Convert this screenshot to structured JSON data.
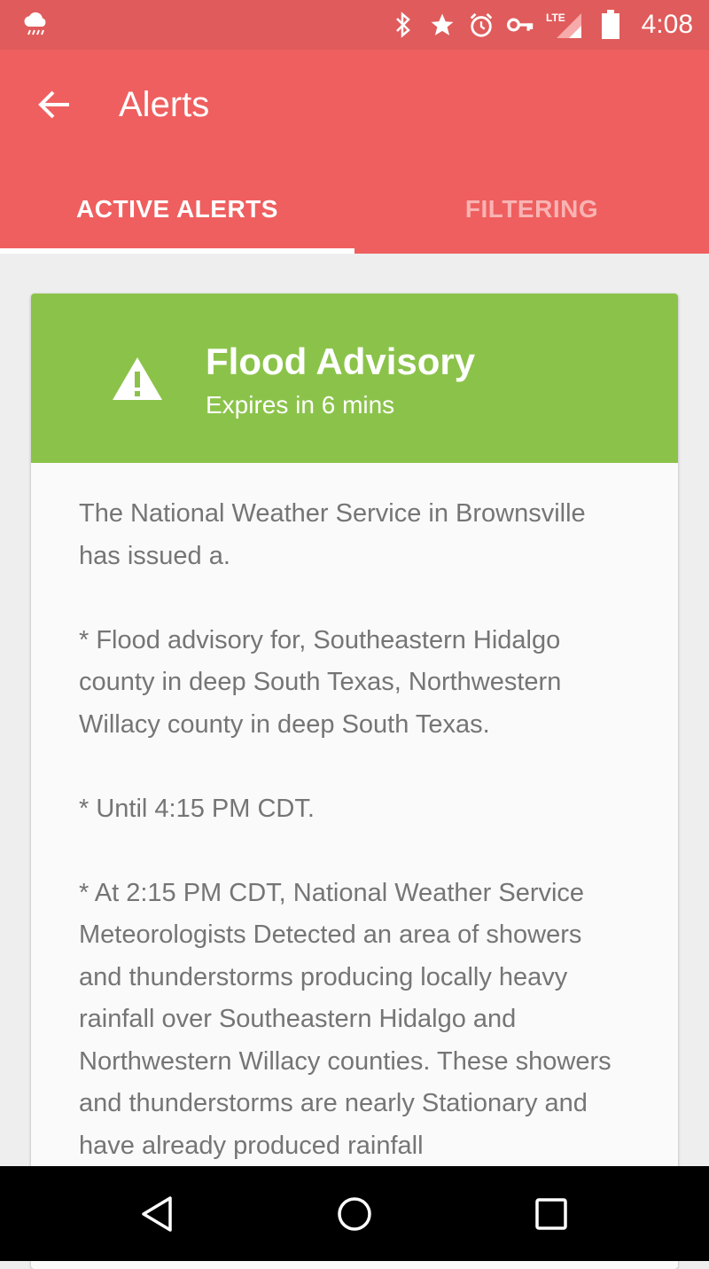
{
  "status_bar": {
    "time": "4:08",
    "network_label": "LTE",
    "icons": [
      "weather-rain-icon",
      "bluetooth-icon",
      "star-icon",
      "alarm-icon",
      "vpn-key-icon",
      "signal-icon",
      "battery-icon"
    ]
  },
  "app_bar": {
    "title": "Alerts",
    "back_icon": "arrow-back-icon"
  },
  "tabs": [
    {
      "label": "ACTIVE ALERTS",
      "active": true
    },
    {
      "label": "FILTERING",
      "active": false
    }
  ],
  "alert": {
    "title": "Flood Advisory",
    "expiry": "Expires in 6 mins",
    "icon": "warning-icon",
    "header_color": "#8bc34a",
    "paragraphs": [
      "The National Weather Service in Brownsville has issued a.",
      "* Flood advisory for, Southeastern Hidalgo county in deep South Texas, Northwestern Willacy county in deep South Texas.",
      "* Until 4:15 PM CDT.",
      "* At 2:15 PM CDT, National Weather Service Meteorologists Detected an area of showers and thunderstorms producing locally heavy rainfall over Southeastern Hidalgo and Northwestern Willacy counties. These showers and thunderstorms are nearly Stationary and have already produced rainfall"
    ]
  },
  "nav_bar": {
    "buttons": [
      "back-triangle-icon",
      "home-circle-icon",
      "recents-square-icon"
    ]
  },
  "colors": {
    "status_bar": "#e05b5b",
    "app_bar": "#ef5f5f",
    "tab_inactive_text": "#f9b3b3",
    "body_text": "#757575",
    "background": "#eeeeee"
  }
}
